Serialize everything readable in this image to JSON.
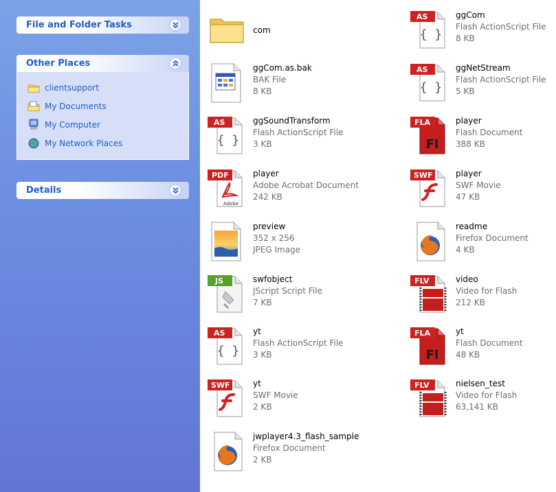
{
  "sidebar": {
    "file_tasks": {
      "title": "File and Folder Tasks"
    },
    "other_places": {
      "title": "Other Places",
      "items": [
        {
          "label": "clientsupport",
          "icon": "folder-icon"
        },
        {
          "label": "My Documents",
          "icon": "my-documents-icon"
        },
        {
          "label": "My Computer",
          "icon": "my-computer-icon"
        },
        {
          "label": "My Network Places",
          "icon": "network-places-icon"
        }
      ]
    },
    "details": {
      "title": "Details"
    }
  },
  "files": [
    {
      "name": "com",
      "line1": "",
      "line2": "",
      "type": "folder"
    },
    {
      "name": "ggCom",
      "line1": "Flash ActionScript File",
      "line2": "8 KB",
      "type": "as"
    },
    {
      "name": "ggCom.as.bak",
      "line1": "BAK File",
      "line2": "8 KB",
      "type": "bak"
    },
    {
      "name": "ggNetStream",
      "line1": "Flash ActionScript File",
      "line2": "5 KB",
      "type": "as"
    },
    {
      "name": "ggSoundTransform",
      "line1": "Flash ActionScript File",
      "line2": "3 KB",
      "type": "as"
    },
    {
      "name": "player",
      "line1": "Flash Document",
      "line2": "388 KB",
      "type": "fla"
    },
    {
      "name": "player",
      "line1": "Adobe Acrobat Document",
      "line2": "242 KB",
      "type": "pdf"
    },
    {
      "name": "player",
      "line1": "SWF Movie",
      "line2": "47 KB",
      "type": "swf"
    },
    {
      "name": "preview",
      "line1": "352 x 256",
      "line2": "JPEG Image",
      "type": "jpg"
    },
    {
      "name": "readme",
      "line1": "Firefox Document",
      "line2": "4 KB",
      "type": "firefox"
    },
    {
      "name": "swfobject",
      "line1": "JScript Script File",
      "line2": "7 KB",
      "type": "js"
    },
    {
      "name": "video",
      "line1": "Video for Flash",
      "line2": "212 KB",
      "type": "flv"
    },
    {
      "name": "yt",
      "line1": "Flash ActionScript File",
      "line2": "3 KB",
      "type": "as"
    },
    {
      "name": "yt",
      "line1": "Flash Document",
      "line2": "48 KB",
      "type": "fla"
    },
    {
      "name": "yt",
      "line1": "SWF Movie",
      "line2": "2 KB",
      "type": "swf"
    },
    {
      "name": "nielsen_test",
      "line1": "Video for Flash",
      "line2": "63,141 KB",
      "type": "flv"
    },
    {
      "name": "jwplayer4.3_flash_sample",
      "line1": "Firefox Document",
      "line2": "2 KB",
      "type": "firefox"
    }
  ],
  "badges": {
    "as": "AS",
    "fla": "FLA",
    "pdf": "PDF",
    "swf": "SWF",
    "js": "JS",
    "flv": "FLV"
  }
}
